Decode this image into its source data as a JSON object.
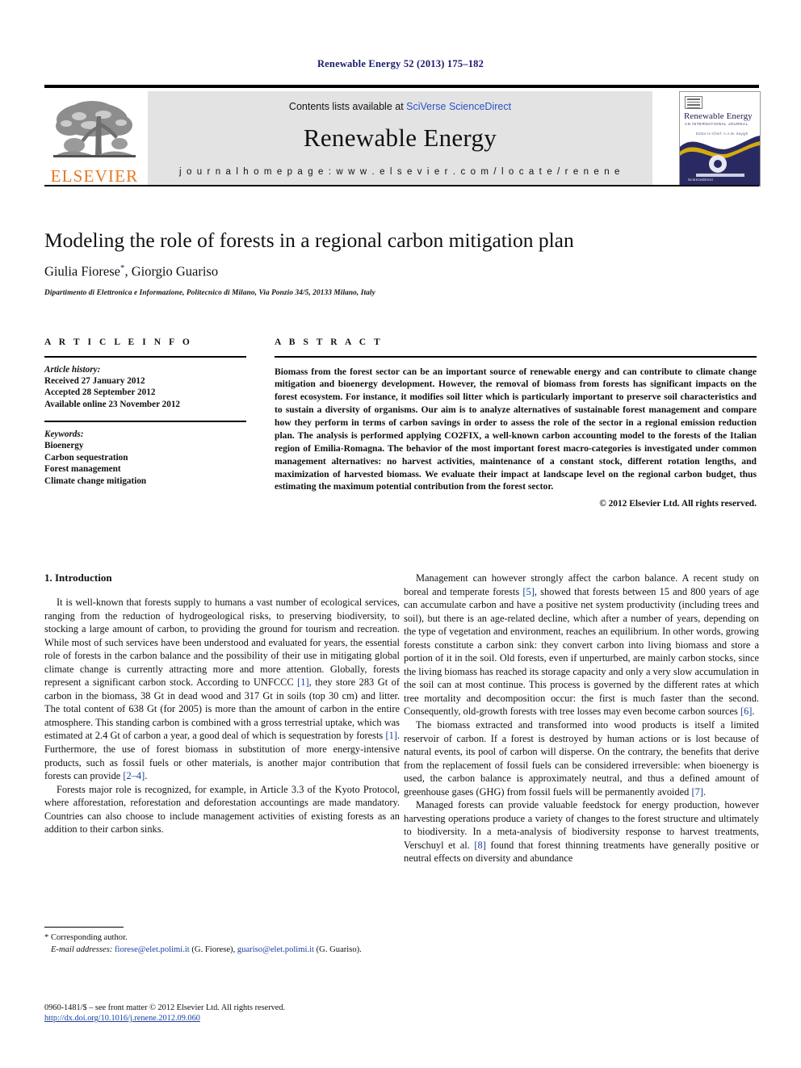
{
  "running_head": "Renewable Energy 52 (2013) 175–182",
  "masthead": {
    "publisher_name": "ELSEVIER",
    "publisher_logo": "elsevier-tree-logo",
    "contents_prefix": "Contents lists available at ",
    "contents_link": "SciVerse ScienceDirect",
    "journal_title": "Renewable Energy",
    "homepage": "j o u r n a l   h o m e p a g e :   w w w . e l s e v i e r . c o m / l o c a t e / r e n e n e",
    "cover": {
      "title": "Renewable Energy",
      "subtitle": "AN INTERNATIONAL JOURNAL",
      "editors": "Editor-in-Chief: A.A.M. Sayigh",
      "sciencedirect": "ScienceDirect"
    }
  },
  "article": {
    "title": "Modeling the role of forests in a regional carbon mitigation plan",
    "authors": "Giulia Fiorese",
    "authors_star": "*",
    "authors_rest": ", Giorgio Guariso",
    "affiliation": "Dipartimento di Elettronica e Informazione, Politecnico di Milano, Via Ponzio 34/5, 20133 Milano, Italy"
  },
  "article_info": {
    "heading": "A R T I C L E   I N F O",
    "history_label": "Article history:",
    "history": [
      "Received 27 January 2012",
      "Accepted 28 September 2012",
      "Available online 23 November 2012"
    ],
    "keywords_label": "Keywords:",
    "keywords": [
      "Bioenergy",
      "Carbon sequestration",
      "Forest management",
      "Climate change mitigation"
    ]
  },
  "abstract": {
    "heading": "A B S T R A C T",
    "body": "Biomass from the forest sector can be an important source of renewable energy and can contribute to climate change mitigation and bioenergy development. However, the removal of biomass from forests has significant impacts on the forest ecosystem. For instance, it modifies soil litter which is particularly important to preserve soil characteristics and to sustain a diversity of organisms. Our aim is to analyze alternatives of sustainable forest management and compare how they perform in terms of carbon savings in order to assess the role of the sector in a regional emission reduction plan. The analysis is performed applying CO2FIX, a well-known carbon accounting model to the forests of the Italian region of Emilia-Romagna. The behavior of the most important forest macro-categories is investigated under common management alternatives: no harvest activities, maintenance of a constant stock, different rotation lengths, and maximization of harvested biomass. We evaluate their impact at landscape level on the regional carbon budget, thus estimating the maximum potential contribution from the forest sector.",
    "copyright": "© 2012 Elsevier Ltd. All rights reserved."
  },
  "body": {
    "section_heading": "1.  Introduction",
    "left_paragraphs": [
      {
        "parts": [
          {
            "t": "It is well-known that forests supply to humans a vast number of ecological services, ranging from the reduction of hydrogeological risks, to preserving biodiversity, to stocking a large amount of carbon, to providing the ground for tourism and recreation. While most of such services have been understood and evaluated for years, the essential role of forests in the carbon balance and the possibility of their use in mitigating global climate change is currently attracting more and more attention. Globally, forests represent a significant carbon stock. According to UNFCCC "
          },
          {
            "t": "[1]",
            "ref": true
          },
          {
            "t": ", they store 283 Gt of carbon in the biomass, 38 Gt in dead wood and 317 Gt in soils (top 30 cm) and litter. The total content of 638 Gt (for 2005) is more than the amount of carbon in the entire atmosphere. This standing carbon is combined with a gross terrestrial uptake, which was estimated at 2.4 Gt of carbon a year, a good deal of which is sequestration by forests "
          },
          {
            "t": "[1]",
            "ref": true
          },
          {
            "t": ". Furthermore, the use of forest biomass in substitution of more energy-intensive products, such as fossil fuels or other materials, is another major contribution that forests can provide "
          },
          {
            "t": "[2–4]",
            "ref": true
          },
          {
            "t": "."
          }
        ]
      },
      {
        "parts": [
          {
            "t": "Forests major role is recognized, for example, in Article 3.3 of the Kyoto Protocol, where afforestation, reforestation and deforestation accountings are made mandatory. Countries can also choose to include management activities of existing forests as an addition to their carbon sinks."
          }
        ]
      }
    ],
    "right_paragraphs": [
      {
        "parts": [
          {
            "t": "Management can however strongly affect the carbon balance. A recent study on boreal and temperate forests "
          },
          {
            "t": "[5]",
            "ref": true
          },
          {
            "t": ", showed that forests between 15 and 800 years of age can accumulate carbon and have a positive net system productivity (including trees and soil), but there is an age-related decline, which after a number of years, depending on the type of vegetation and environment, reaches an equilibrium. In other words, growing forests constitute a carbon sink: they convert carbon into living biomass and store a portion of it in the soil. Old forests, even if unperturbed, are mainly carbon stocks, since the living biomass has reached its storage capacity and only a very slow accumulation in the soil can at most continue. This process is governed by the different rates at which tree mortality and decomposition occur: the first is much faster than the second. Consequently, old-growth forests with tree losses may even become carbon sources "
          },
          {
            "t": "[6]",
            "ref": true
          },
          {
            "t": "."
          }
        ]
      },
      {
        "parts": [
          {
            "t": "The biomass extracted and transformed into wood products is itself a limited reservoir of carbon. If a forest is destroyed by human actions or is lost because of natural events, its pool of carbon will disperse. On the contrary, the benefits that derive from the replacement of fossil fuels can be considered irreversible: when bioenergy is used, the carbon balance is approximately neutral, and thus a defined amount of greenhouse gases (GHG) from fossil fuels will be permanently avoided "
          },
          {
            "t": "[7]",
            "ref": true
          },
          {
            "t": "."
          }
        ]
      },
      {
        "parts": [
          {
            "t": "Managed forests can provide valuable feedstock for energy production, however harvesting operations produce a variety of changes to the forest structure and ultimately to biodiversity. In a meta-analysis of biodiversity response to harvest treatments, Verschuyl et al. "
          },
          {
            "t": "[8]",
            "ref": true
          },
          {
            "t": " found that forest thinning treatments have generally positive or neutral effects on diversity and abundance"
          }
        ]
      }
    ]
  },
  "footnote": {
    "corresponding": "* Corresponding author.",
    "email_label": "E-mail addresses:",
    "email1": "fiorese@elet.polimi.it",
    "email1_who": "(G. Fiorese),",
    "email2": "guariso@elet.polimi.it",
    "email2_who": "(G. Guariso)."
  },
  "footer": {
    "issn_line": "0960-1481/$ – see front matter © 2012 Elsevier Ltd. All rights reserved.",
    "doi": "http://dx.doi.org/10.1016/j.renene.2012.09.060"
  },
  "colors": {
    "running_head": "#1a1a6e",
    "link": "#2b52c6",
    "reference": "#1a3fa0",
    "elsevier_orange": "#E87722",
    "banner_gray": "#e3e3e3",
    "cover_navy": "#2a2a63"
  }
}
